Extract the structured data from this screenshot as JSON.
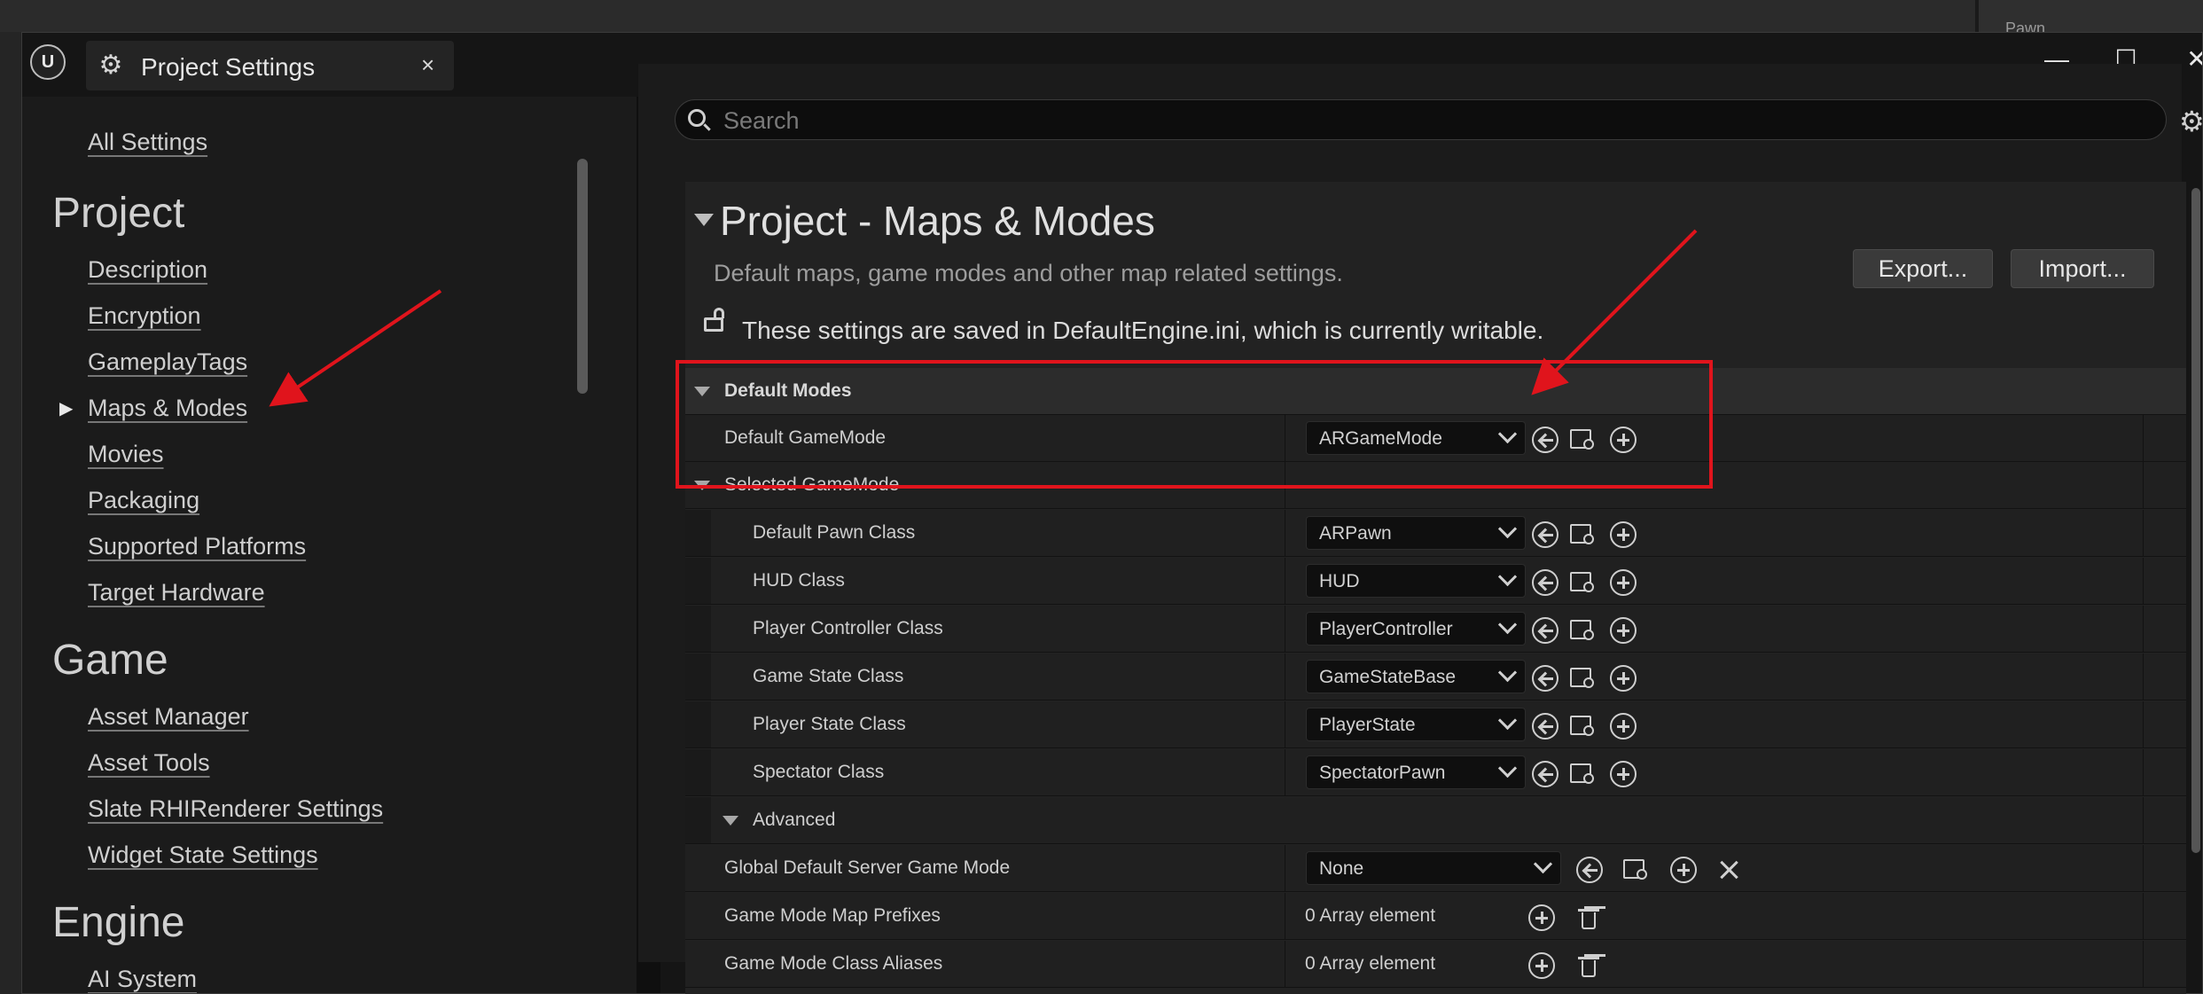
{
  "background": {
    "right_panel_label": "Pawn"
  },
  "window": {
    "tab_title": "Project Settings",
    "tab_icon": "settings-gear-icon",
    "close_glyph": "×",
    "minimize_glyph": "—",
    "maximize_glyph": "☐",
    "window_close_glyph": "✕"
  },
  "sidebar": {
    "all_settings": "All Settings",
    "sections": [
      {
        "title": "Project",
        "items": [
          "Description",
          "Encryption",
          "GameplayTags",
          "Maps & Modes",
          "Movies",
          "Packaging",
          "Supported Platforms",
          "Target Hardware"
        ]
      },
      {
        "title": "Game",
        "items": [
          "Asset Manager",
          "Asset Tools",
          "Slate RHIRenderer Settings",
          "Widget State Settings"
        ]
      },
      {
        "title": "Engine",
        "items": [
          "AI System"
        ]
      }
    ],
    "selected": "Maps & Modes"
  },
  "search": {
    "placeholder": "Search"
  },
  "section": {
    "title": "Project - Maps & Modes",
    "description": "Default maps, game modes and other map related settings.",
    "export_label": "Export...",
    "import_label": "Import...",
    "writable_note": "These settings are saved in DefaultEngine.ini, which is currently writable."
  },
  "properties": {
    "default_modes": "Default Modes",
    "default_gamemode": {
      "label": "Default GameMode",
      "value": "ARGameMode"
    },
    "selected_gamemode": "Selected GameMode",
    "class_rows": [
      {
        "label": "Default Pawn Class",
        "value": "ARPawn"
      },
      {
        "label": "HUD Class",
        "value": "HUD"
      },
      {
        "label": "Player Controller Class",
        "value": "PlayerController"
      },
      {
        "label": "Game State Class",
        "value": "GameStateBase"
      },
      {
        "label": "Player State Class",
        "value": "PlayerState"
      },
      {
        "label": "Spectator Class",
        "value": "SpectatorPawn"
      }
    ],
    "advanced": "Advanced",
    "server_game_mode": {
      "label": "Global Default Server Game Mode",
      "value": "None"
    },
    "map_prefixes": {
      "label": "Game Mode Map Prefixes",
      "value": "0 Array element"
    },
    "class_aliases": {
      "label": "Game Mode Class Aliases",
      "value": "0 Array element"
    }
  },
  "colors": {
    "annotation": "#e0141c",
    "panel": "#222222",
    "sidebar": "#1b1b1b"
  }
}
